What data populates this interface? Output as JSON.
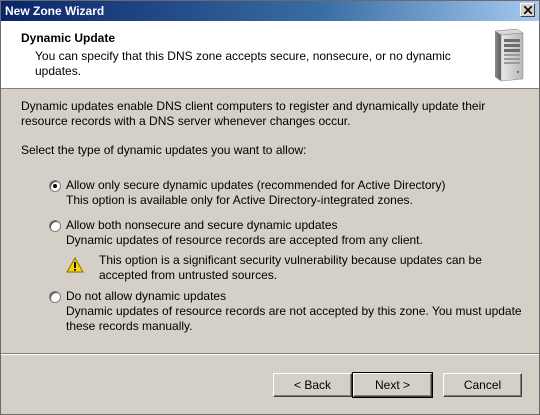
{
  "window": {
    "title": "New Zone Wizard"
  },
  "header": {
    "heading": "Dynamic Update",
    "subheading_line1": "You can specify that this DNS zone accepts secure, nonsecure, or no dynamic",
    "subheading_line2": "updates.",
    "icon": "server-icon"
  },
  "body": {
    "intro_line1": "Dynamic updates enable DNS client computers to register and dynamically update their",
    "intro_line2": "resource records with a DNS server whenever changes occur.",
    "prompt": "Select the type of dynamic updates you want to allow:",
    "options": [
      {
        "label": "Allow only secure dynamic updates (recommended for Active Directory)",
        "description": "This option is available only for Active Directory-integrated zones.",
        "selected": true
      },
      {
        "label": "Allow both nonsecure and secure dynamic updates",
        "description": "Dynamic updates of resource records are accepted from any client.",
        "warning_line1": "This option is a significant security vulnerability because updates can be",
        "warning_line2": "accepted from untrusted sources.",
        "selected": false
      },
      {
        "label": "Do not allow dynamic updates",
        "description_line1": "Dynamic updates of resource records are not accepted by this zone. You must update",
        "description_line2": "these records manually.",
        "selected": false
      }
    ]
  },
  "footer": {
    "back_label": "< Back",
    "next_label": "Next >",
    "cancel_label": "Cancel"
  },
  "colors": {
    "title_gradient_start": "#0a246a",
    "title_gradient_end": "#a6caf0",
    "dialog_bg": "#d4d0c8",
    "header_bg": "#ffffff",
    "warning_yellow": "#f5d800"
  }
}
